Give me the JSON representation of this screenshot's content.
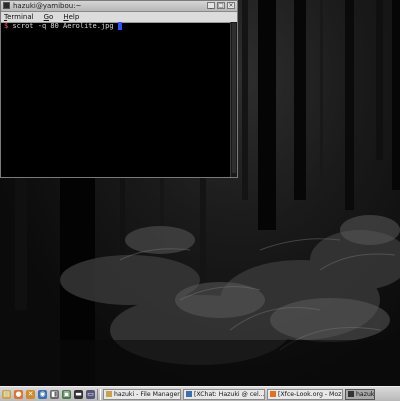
{
  "terminal": {
    "title": "hazuki@yamibou:~",
    "menu": [
      {
        "label": "Terminal",
        "accel_index": 0
      },
      {
        "label": "Go",
        "accel_index": 0
      },
      {
        "label": "Help",
        "accel_index": 0
      }
    ],
    "prompt_symbol": "$",
    "command": "scrot -q 80 Aerolite.jpg",
    "window_buttons": [
      "minimize",
      "maximize",
      "close"
    ]
  },
  "taskbar": {
    "launchers": [
      {
        "icon": "files-icon",
        "color": "#c8a34a"
      },
      {
        "icon": "firefox-icon",
        "color": "#e0702a"
      },
      {
        "icon": "xfce-mouse-icon",
        "color": "#d08a2a"
      },
      {
        "icon": "thunderbird-icon",
        "color": "#3a6fb0"
      },
      {
        "icon": "settings-icon",
        "color": "#6a6a6a"
      },
      {
        "icon": "image-viewer-icon",
        "color": "#4a7a4a"
      },
      {
        "icon": "terminal-icon",
        "color": "#333333"
      },
      {
        "icon": "monitor-icon",
        "color": "#555577"
      }
    ],
    "tasks": [
      {
        "label": "hazuki - File Manager",
        "icon_color": "#c8a34a",
        "active": false
      },
      {
        "label": "[XChat: Hazuki @ cel...",
        "icon_color": "#3a6fb0",
        "active": false
      },
      {
        "label": "[Xfce-Look.org - Mozil...",
        "icon_color": "#e0702a",
        "active": false
      },
      {
        "label": "hazuki",
        "icon_color": "#333333",
        "active": true
      }
    ]
  }
}
